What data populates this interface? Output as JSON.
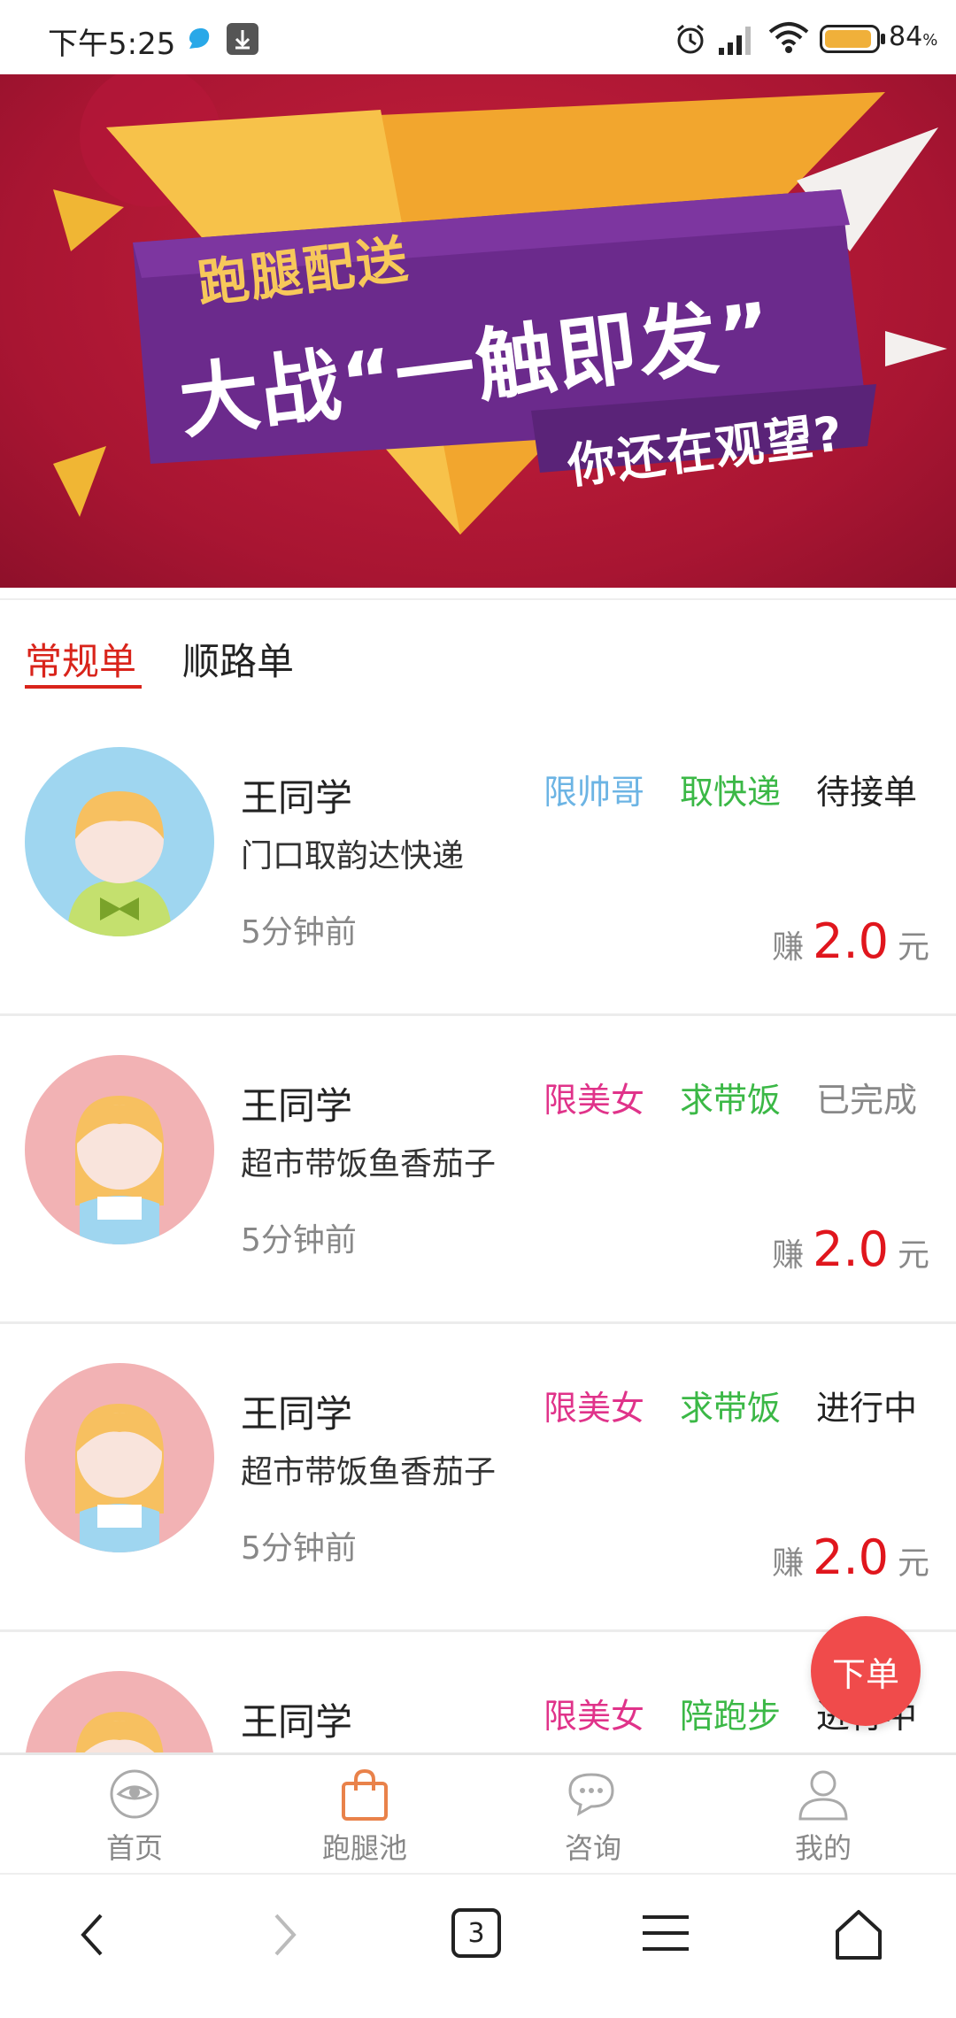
{
  "status_bar": {
    "time": "下午5:25",
    "battery": "84",
    "battery_unit": "%",
    "icons": [
      "app-bubble-icon",
      "download-icon",
      "alarm-icon",
      "signal-icon",
      "wifi-icon",
      "battery-icon"
    ]
  },
  "banner": {
    "line1": "跑腿配送",
    "line2": "大战“一触即发”",
    "line3": "你还在观望?"
  },
  "tabs": [
    {
      "label": "常规单",
      "active": true
    },
    {
      "label": "顺路单",
      "active": false
    }
  ],
  "orders": [
    {
      "name": "王同学",
      "desc": "门口取韵达快递",
      "time": "5分钟前",
      "tag1": "限帅哥",
      "tag1_color": "#6cb4e4",
      "tag2": "取快递",
      "tag2_color": "#3bb846",
      "status": "待接单",
      "status_color": "#222222",
      "earn_prefix": "赚",
      "earn_value": "2.0",
      "earn_unit": "元",
      "avatar": "boy-avatar-icon"
    },
    {
      "name": "王同学",
      "desc": "超市带饭鱼香茄子",
      "time": "5分钟前",
      "tag1": "限美女",
      "tag1_color": "#e0338a",
      "tag2": "求带饭",
      "tag2_color": "#3bb846",
      "status": "已完成",
      "status_color": "#888888",
      "earn_prefix": "赚",
      "earn_value": "2.0",
      "earn_unit": "元",
      "avatar": "girl-avatar-icon"
    },
    {
      "name": "王同学",
      "desc": "超市带饭鱼香茄子",
      "time": "5分钟前",
      "tag1": "限美女",
      "tag1_color": "#e0338a",
      "tag2": "求带饭",
      "tag2_color": "#3bb846",
      "status": "进行中",
      "status_color": "#222222",
      "earn_prefix": "赚",
      "earn_value": "2.0",
      "earn_unit": "元",
      "avatar": "girl-avatar-icon"
    },
    {
      "name": "王同学",
      "desc": "",
      "time": "",
      "tag1": "限美女",
      "tag1_color": "#e0338a",
      "tag2": "陪跑步",
      "tag2_color": "#3bb846",
      "status": "进行中",
      "status_color": "#222222",
      "earn_prefix": "",
      "earn_value": "",
      "earn_unit": "",
      "avatar": "girl-avatar-icon"
    }
  ],
  "fab": {
    "label": "下单"
  },
  "tabbar": [
    {
      "label": "首页",
      "icon": "eye-icon"
    },
    {
      "label": "跑腿池",
      "icon": "shopping-bag-icon",
      "active": true
    },
    {
      "label": "咨询",
      "icon": "chat-bubble-icon"
    },
    {
      "label": "我的",
      "icon": "person-icon"
    }
  ],
  "browser_nav": {
    "tab_count": "3"
  },
  "colors": {
    "accent_red": "#d9241b",
    "price_red": "#e0161d",
    "fab_red": "#f04b4b",
    "bag_orange": "#e9824a"
  }
}
